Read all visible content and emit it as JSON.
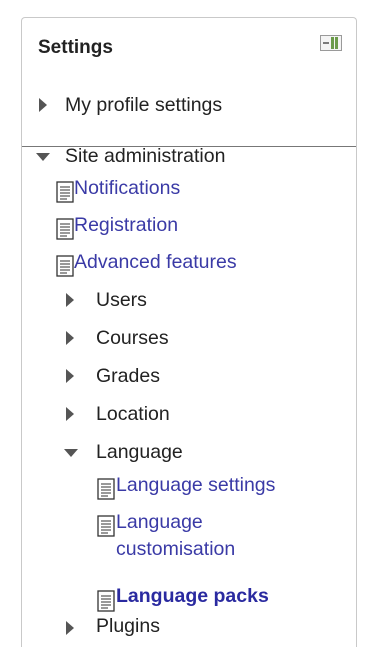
{
  "block": {
    "title": "Settings",
    "dock_icon": "dock-block-icon"
  },
  "my_profile": {
    "label": "My profile settings",
    "icon": "triangle-right-icon"
  },
  "site_admin": {
    "label": "Site administration",
    "icon": "triangle-down-icon",
    "pages": [
      {
        "label": "Notifications",
        "icon": "page-icon"
      },
      {
        "label": "Registration",
        "icon": "page-icon"
      },
      {
        "label": "Advanced features",
        "icon": "page-icon"
      }
    ],
    "sections": [
      {
        "label": "Users",
        "icon": "triangle-right-icon"
      },
      {
        "label": "Courses",
        "icon": "triangle-right-icon"
      },
      {
        "label": "Grades",
        "icon": "triangle-right-icon"
      },
      {
        "label": "Location",
        "icon": "triangle-right-icon"
      }
    ],
    "language": {
      "label": "Language",
      "icon": "triangle-down-icon",
      "items": [
        {
          "label": "Language settings",
          "icon": "page-icon"
        },
        {
          "label_line1": "Language",
          "label_line2": "customisation",
          "icon": "page-icon"
        },
        {
          "label": "Language packs",
          "icon": "page-icon",
          "active": true
        }
      ]
    },
    "plugins": {
      "label": "Plugins",
      "icon": "triangle-right-icon"
    }
  },
  "colors": {
    "link": "#3a3aa6",
    "active_link": "#2a2aa0",
    "text": "#222222",
    "border": "#c9c9c9"
  }
}
